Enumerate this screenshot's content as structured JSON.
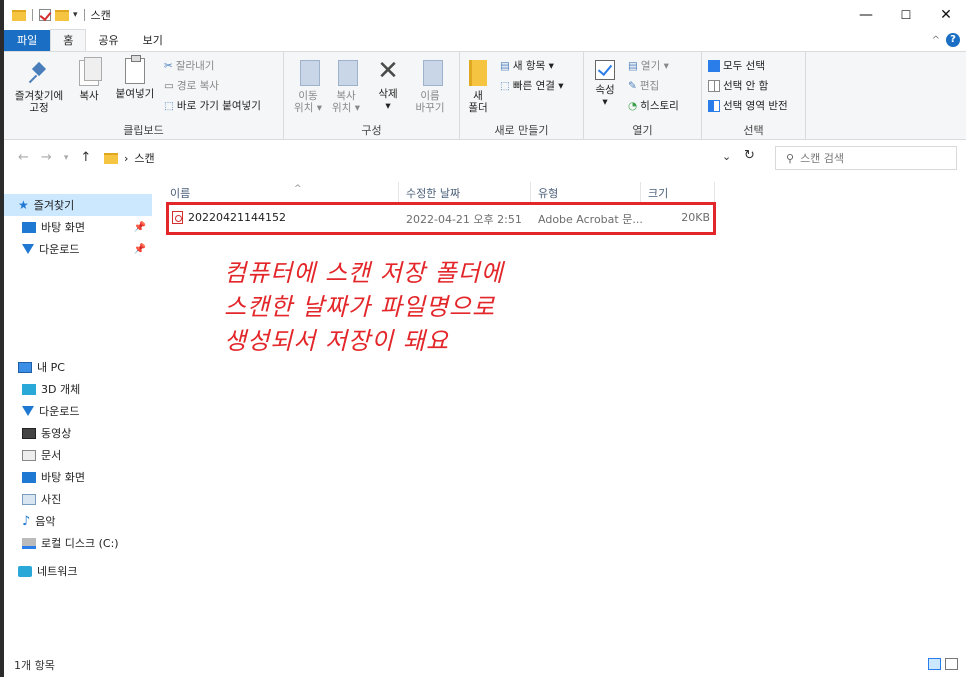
{
  "window": {
    "title": "스캔",
    "controls": {
      "minimize": "—",
      "maximize": "☐",
      "close": "✕"
    }
  },
  "ribbon_tabs": [
    {
      "label": "파일"
    },
    {
      "label": "홈"
    },
    {
      "label": "공유"
    },
    {
      "label": "보기"
    }
  ],
  "ribbon": {
    "clipboard": {
      "pin_label_1": "즐겨찾기에",
      "pin_label_2": "고정",
      "copy_label": "복사",
      "paste_label": "붙여넣기",
      "cut_label": "잘라내기",
      "copy_path_label": "경로 복사",
      "paste_shortcut_label": "바로 가기 붙여넣기",
      "group_label": "클립보드"
    },
    "organize": {
      "move_label_1": "이동",
      "move_label_2": "위치 ▾",
      "copyto_label_1": "복사",
      "copyto_label_2": "위치 ▾",
      "delete_label_1": "삭제",
      "delete_label_2": "▾",
      "rename_label_1": "이름",
      "rename_label_2": "바꾸기",
      "group_label": "구성"
    },
    "new": {
      "new_folder_label_1": "새",
      "new_folder_label_2": "폴더",
      "new_item_label": "새 항목 ▾",
      "easy_access_label": "빠른 연결 ▾",
      "group_label": "새로 만들기"
    },
    "open": {
      "properties_label_1": "속성",
      "properties_label_2": "▾",
      "open_label": "열기 ▾",
      "edit_label": "편집",
      "history_label": "히스토리",
      "group_label": "열기"
    },
    "select": {
      "select_all_label": "모두 선택",
      "select_none_label": "선택 안 함",
      "invert_label": "선택 영역 반전",
      "group_label": "선택"
    }
  },
  "address": {
    "separator": "›",
    "path": "스캔",
    "search_placeholder": "스캔 검색"
  },
  "nav_pane": {
    "quick_access": "즐겨찾기",
    "quick_items": [
      "바탕 화면",
      "다운로드"
    ],
    "this_pc": "내 PC",
    "pc_items": [
      "3D 개체",
      "다운로드",
      "동영상",
      "문서",
      "바탕 화면",
      "사진",
      "음악",
      "로컬 디스크 (C:)"
    ],
    "network": "네트워크"
  },
  "columns": {
    "name": "이름",
    "modified": "수정한 날짜",
    "type": "유형",
    "size": "크기"
  },
  "files": [
    {
      "name": "20220421144152",
      "modified": "2022-04-21 오후 2:51",
      "type": "Adobe Acrobat 문...",
      "size": "20KB"
    }
  ],
  "annotation": {
    "line1": "컴퓨터에 스캔 저장 폴더에",
    "line2": "스캔한 날짜가 파일명으로",
    "line3": "생성되서 저장이 돼요"
  },
  "status": {
    "item_count": "1개 항목"
  },
  "colors": {
    "accent": "#1a6fc4",
    "annotation_red": "#e3262a",
    "selection": "#cce8ff"
  }
}
